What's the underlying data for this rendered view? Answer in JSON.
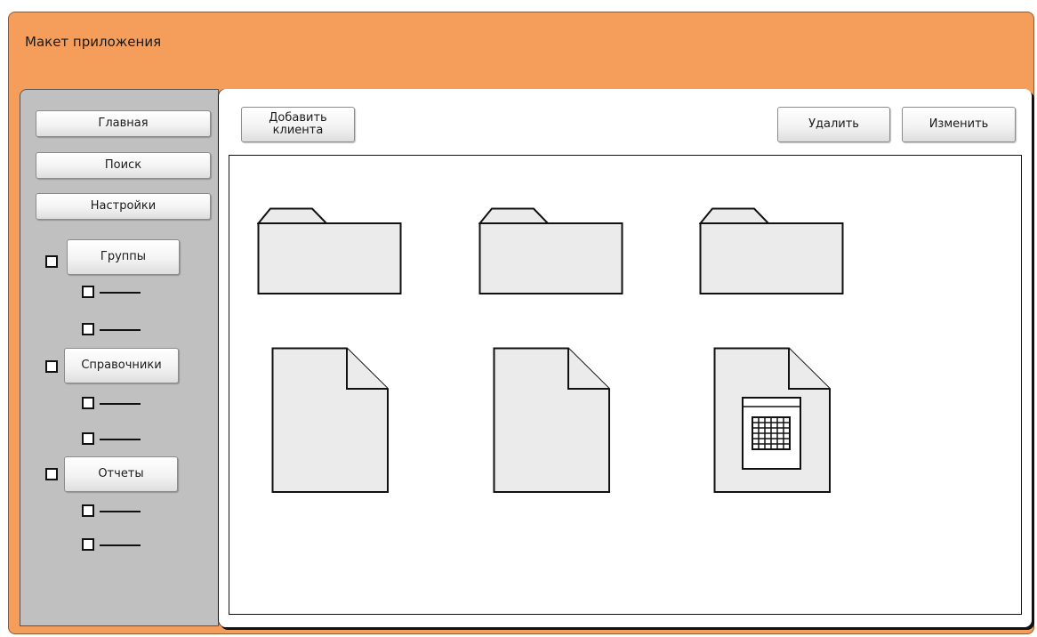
{
  "app": {
    "title": "Макет приложения"
  },
  "sidebar": {
    "nav_buttons": [
      {
        "label": "Главная"
      },
      {
        "label": "Поиск"
      },
      {
        "label": "Настройки"
      }
    ],
    "tree": [
      {
        "label": "Группы",
        "children": [
          "",
          ""
        ]
      },
      {
        "label": "Справочники",
        "children": [
          "",
          ""
        ]
      },
      {
        "label": "Отчеты",
        "children": [
          "",
          ""
        ]
      }
    ]
  },
  "toolbar": {
    "add_client_label": "Добавить клиента",
    "delete_label": "Удалить",
    "edit_label": "Изменить"
  },
  "content": {
    "items": [
      {
        "icon": "folder-icon"
      },
      {
        "icon": "folder-icon"
      },
      {
        "icon": "folder-icon"
      },
      {
        "icon": "document-icon"
      },
      {
        "icon": "document-icon"
      },
      {
        "icon": "spreadsheet-document-icon"
      }
    ]
  },
  "colors": {
    "window_background": "#F59E5C",
    "sidebar_background": "#C0C0C0",
    "icon_fill": "#EBEBEB",
    "stroke": "#111111"
  }
}
